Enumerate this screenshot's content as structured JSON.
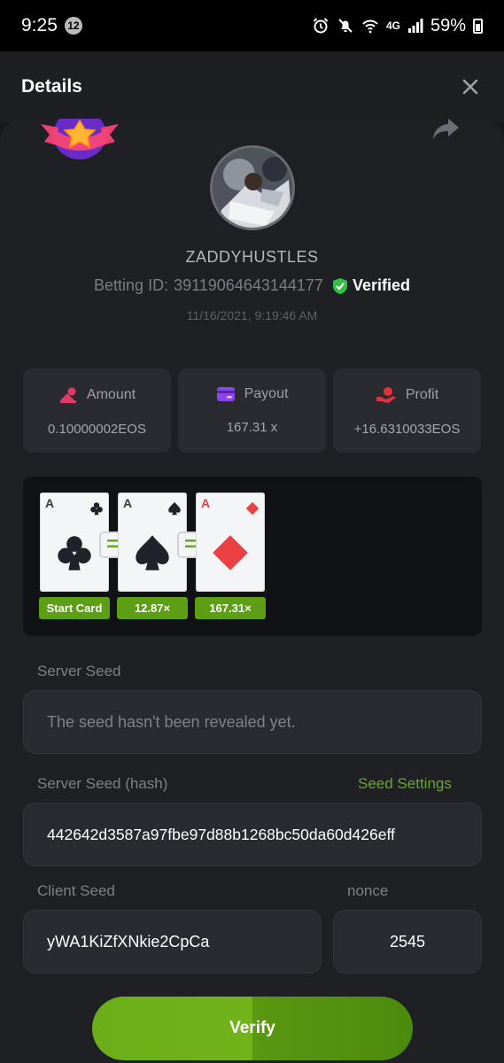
{
  "status_bar": {
    "time": "9:25",
    "notification_count": "12",
    "network": "4G",
    "battery": "59%"
  },
  "header": {
    "title": "Details"
  },
  "user": {
    "name": "ZADDYHUSTLES",
    "betting_label": "Betting ID:",
    "betting_id": "39119064643144177",
    "verified_label": "Verified",
    "timestamp": "11/16/2021, 9:19:46 AM"
  },
  "stats": [
    {
      "label": "Amount",
      "value": "0.10000002EOS",
      "icon": "coins-icon",
      "color": "#e5396a"
    },
    {
      "label": "Payout",
      "value": "167.31 x",
      "icon": "wallet-icon",
      "color": "#8b46e8"
    },
    {
      "label": "Profit",
      "value": "+16.6310033EOS",
      "icon": "hand-coin-icon",
      "color": "#e0343d"
    }
  ],
  "cards": [
    {
      "rank": "A",
      "suit": "clubs",
      "tag": "Start Card"
    },
    {
      "rank": "A",
      "suit": "spades",
      "tag": "12.87×"
    },
    {
      "rank": "A",
      "suit": "diamonds",
      "tag": "167.31×"
    }
  ],
  "equals_sign": "=",
  "seeds": {
    "server_seed_label": "Server Seed",
    "server_seed_value": "The seed hasn't been revealed yet.",
    "server_hash_label": "Server Seed (hash)",
    "seed_settings_label": "Seed Settings",
    "server_hash_value": "442642d3587a97fbe97d88b1268bc50da60d426eff",
    "client_seed_label": "Client Seed",
    "client_seed_value": "yWA1KiZfXNkie2CpCa",
    "nonce_label": "nonce",
    "nonce_value": "2545"
  },
  "verify_label": "Verify",
  "colors": {
    "accent_green": "#6aae1a",
    "verified_green": "#2fc145",
    "suit_red": "#ec4142",
    "suit_dark": "#1f2229"
  }
}
